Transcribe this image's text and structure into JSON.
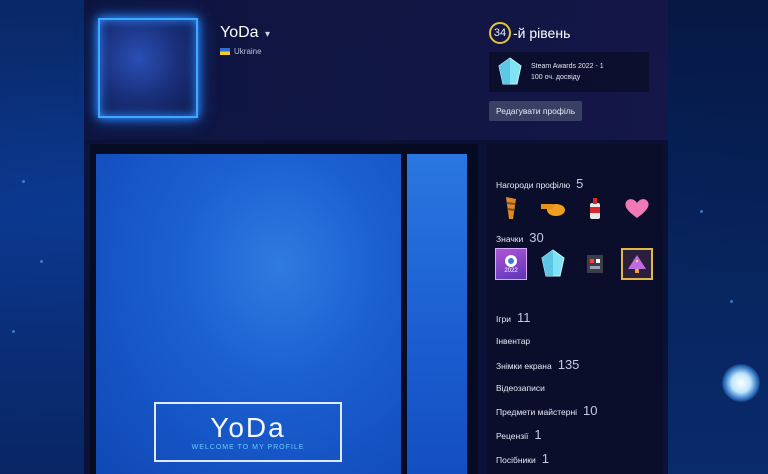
{
  "header": {
    "persona_name": "YoDa",
    "caret": "▾",
    "country": "Ukraine",
    "level_number": "34",
    "level_suffix": "-й рівень",
    "featured_badge": {
      "title": "Steam Awards 2022 - 1",
      "xp": "100 оч. досвіду",
      "icon": "crystal-icon"
    },
    "edit_profile_label": "Редагувати профіль"
  },
  "showcase": {
    "logo_title": "YoDa",
    "logo_subtitle": "WELCOME TO MY PROFILE"
  },
  "sidebar": {
    "awards": {
      "label": "Нагороди профілю",
      "count": "5",
      "icons": [
        "taco-icon",
        "whistle-icon",
        "ketchup-icon",
        "heart-icon"
      ]
    },
    "badges": {
      "label": "Значки",
      "count": "30",
      "icons": [
        "steam-2022-badge-icon",
        "crystal-icon",
        "robot-badge-icon",
        "pixel-tree-badge-icon"
      ],
      "badge_2022_text": "2022"
    },
    "links": [
      {
        "label": "Ігри",
        "count": "11"
      },
      {
        "label": "Інвентар",
        "count": ""
      },
      {
        "label": "Знімки екрана",
        "count": "135"
      },
      {
        "label": "Відеозаписи",
        "count": ""
      },
      {
        "label": "Предмети майстерні",
        "count": "10"
      },
      {
        "label": "Рецензії",
        "count": "1"
      },
      {
        "label": "Посібники",
        "count": "1"
      }
    ]
  },
  "colors": {
    "accent_blue": "#3fa9ff",
    "level_ring": "#e3c33a",
    "crystal": "#7fe3f5"
  }
}
